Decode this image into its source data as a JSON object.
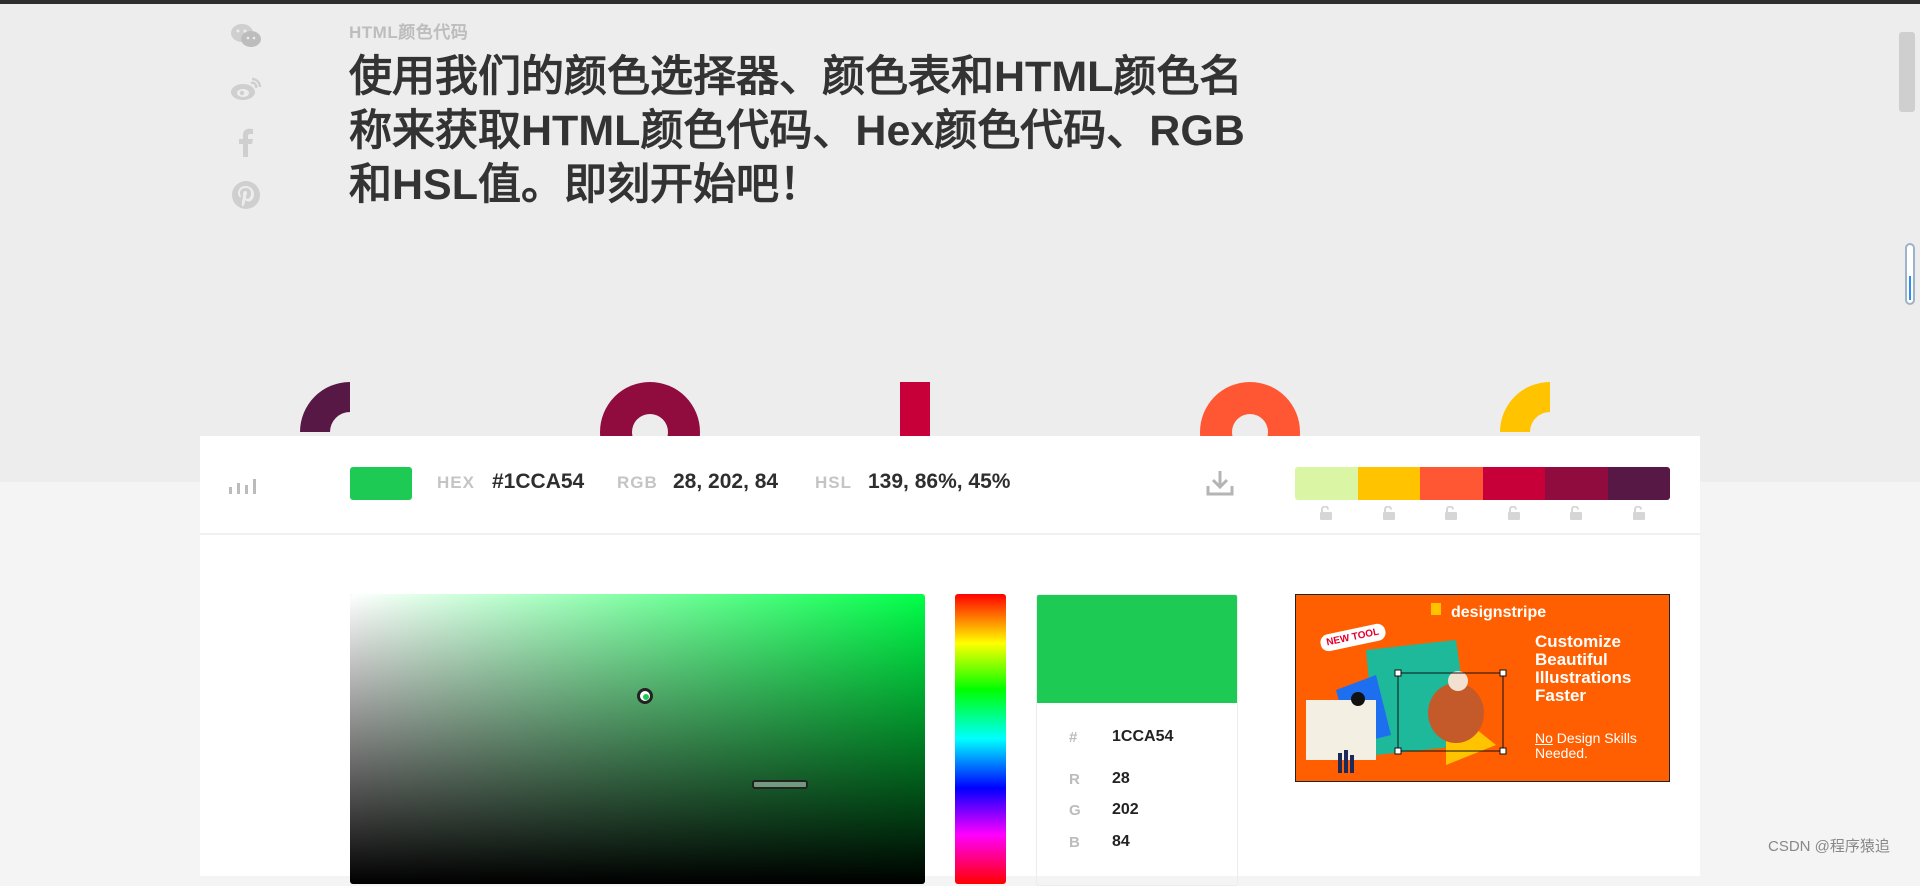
{
  "page": {
    "eyebrow": "HTML颜色代码",
    "headline": "使用我们的颜色选择器、颜色表和HTML颜色名称来获取HTML颜色代码、Hex颜色代码、RGB和HSL值。即刻开始吧！"
  },
  "share": [
    {
      "name": "wechat-icon"
    },
    {
      "name": "weibo-icon"
    },
    {
      "name": "facebook-icon"
    },
    {
      "name": "pinterest-icon"
    }
  ],
  "current_color": {
    "hex_label": "HEX",
    "hex": "#1CCA54",
    "rgb_label": "RGB",
    "rgb": "28, 202, 84",
    "hsl_label": "HSL",
    "hsl": "139, 86%, 45%",
    "swatch": "#1cca54"
  },
  "palette": [
    "#daf5a4",
    "#ffc300",
    "#ff5733",
    "#c70039",
    "#900c3f",
    "#581845"
  ],
  "info": {
    "hash_label": "#",
    "hex_value": "1CCA54",
    "r_label": "R",
    "r": "28",
    "g_label": "G",
    "g": "202",
    "b_label": "B",
    "b": "84"
  },
  "ad": {
    "brand": "designstripe",
    "tag": "NEW TOOL",
    "headline": "Customize Beautiful Illustrations Faster",
    "sub_no": "No",
    "sub_rest": " Design Skills Needed."
  },
  "watermark": "CSDN @程序猿追"
}
